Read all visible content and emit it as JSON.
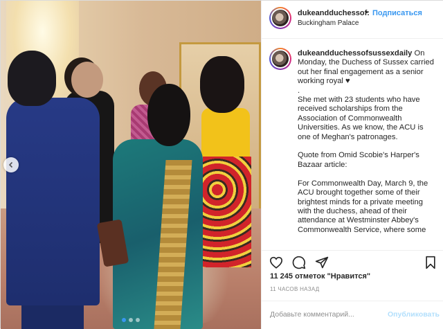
{
  "post": {
    "username": "dukeandduchessof:",
    "follow_label": "Подписаться",
    "separator": "•",
    "location": "Buckingham Palace"
  },
  "caption": {
    "username": "dukeandduchessofsussexdaily",
    "text": " On Monday, the Duchess of Sussex carried out her final engagement as a senior working royal ♥\n.\nShe met with 23 students who have received scholarships from the Association of Commonwealth Universities. As we know, the ACU is one of Meghan's patronages.\n\nQuote from Omid Scobie's Harper's Bazaar article:\n\nFor Commonwealth Day, March 9, the ACU brought together some of their brightest minds for a private meeting with the duchess, ahead of their attendance at Westminster Abbey's Commonwealth Service, where some"
  },
  "actions": {
    "like_icon": "heart-icon",
    "comment_icon": "comment-icon",
    "share_icon": "share-icon",
    "save_icon": "bookmark-icon"
  },
  "likes": "11 245 отметок \"Нравится\"",
  "timestamp": "11 ЧАСОВ НАЗАД",
  "comment": {
    "placeholder": "Добавьте комментарий...",
    "publish_label": "Опубликовать"
  },
  "carousel": {
    "slides": 3,
    "active": 0
  },
  "colors": {
    "link": "#3897f0",
    "text": "#262626",
    "muted": "#8e8e8e"
  }
}
